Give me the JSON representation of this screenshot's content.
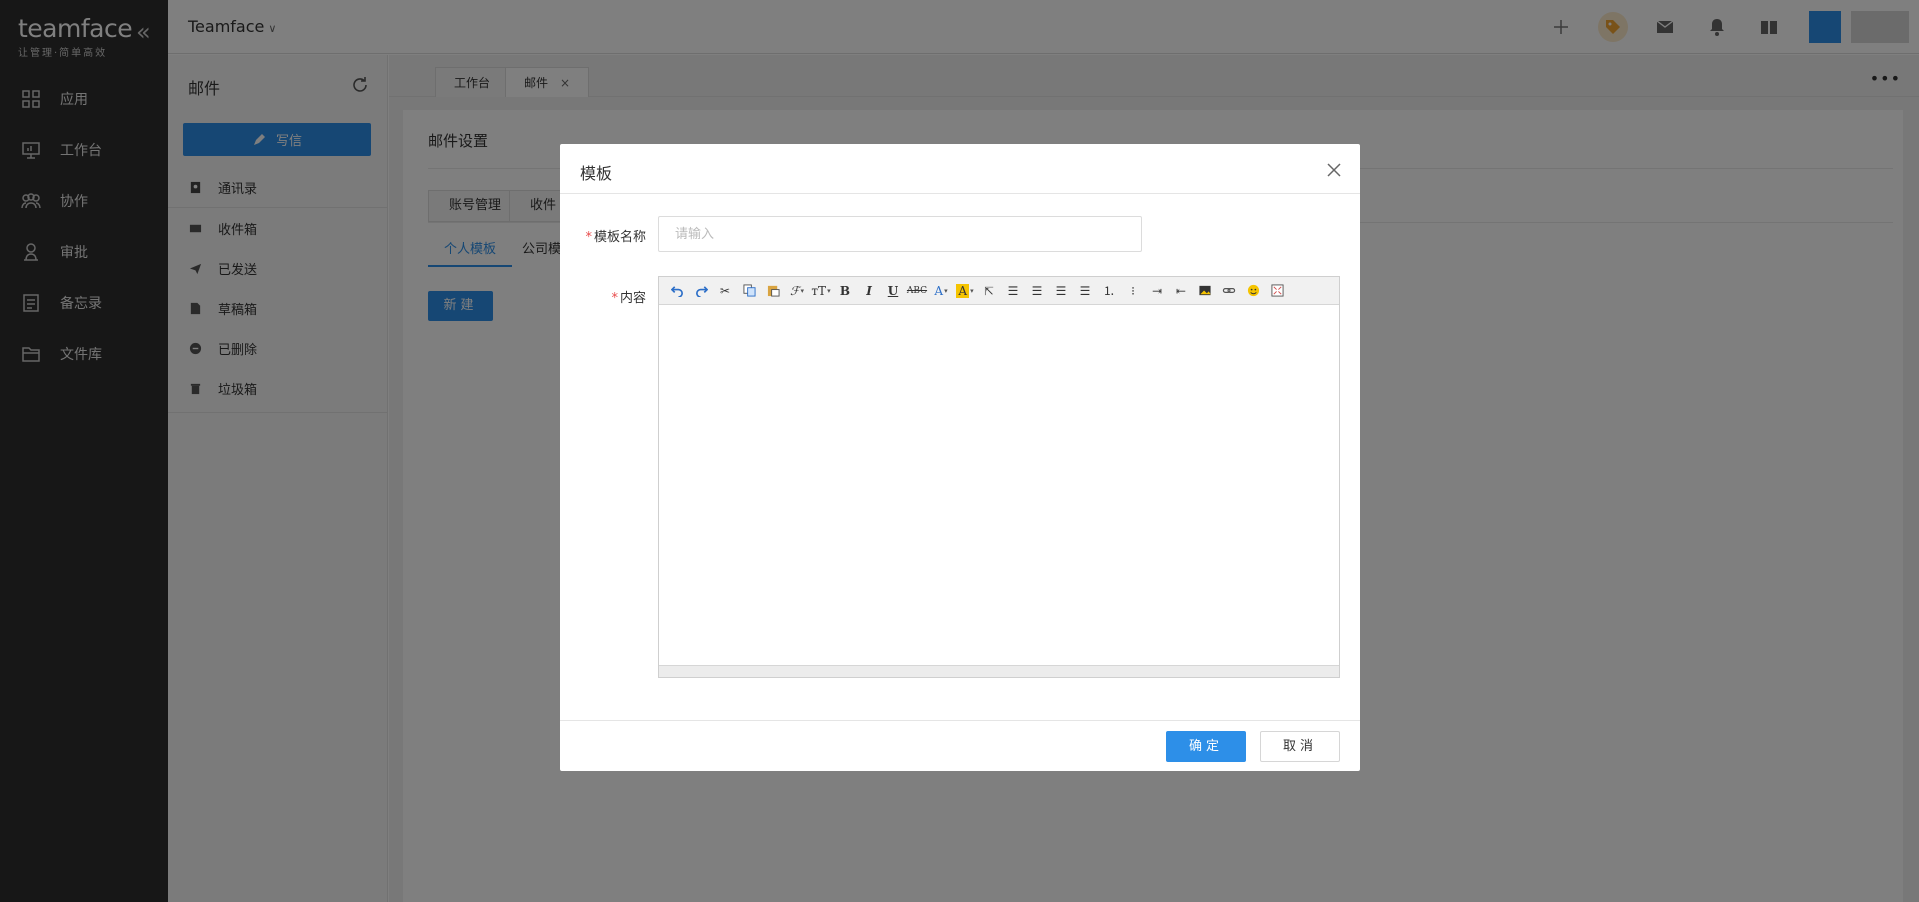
{
  "brand": {
    "logo_text": "teamface",
    "tagline": "让管理·简单高效"
  },
  "leftnav": {
    "items": [
      {
        "label": "应用",
        "icon": "apps-icon"
      },
      {
        "label": "工作台",
        "icon": "dashboard-icon"
      },
      {
        "label": "协作",
        "icon": "collaboration-icon"
      },
      {
        "label": "审批",
        "icon": "approval-icon"
      },
      {
        "label": "备忘录",
        "icon": "memo-icon"
      },
      {
        "label": "文件库",
        "icon": "folder-icon"
      }
    ]
  },
  "header": {
    "company": "Teamface"
  },
  "mail": {
    "title": "邮件",
    "compose_label": "写信",
    "contacts_label": "通讯录",
    "folders": [
      {
        "label": "收件箱"
      },
      {
        "label": "已发送"
      },
      {
        "label": "草稿箱"
      },
      {
        "label": "已删除"
      },
      {
        "label": "垃圾箱"
      }
    ]
  },
  "tabs": [
    {
      "label": "工作台"
    },
    {
      "label": "邮件",
      "active": true
    }
  ],
  "settings": {
    "title": "邮件设置",
    "subtabs": [
      "账号管理",
      "收件"
    ],
    "template_tabs": [
      "个人模板",
      "公司模"
    ],
    "new_button": "新建"
  },
  "modal": {
    "title": "模板",
    "name_label": "模板名称",
    "name_placeholder": "请输入",
    "content_label": "内容",
    "ok_label": "确定",
    "cancel_label": "取消"
  },
  "colors": {
    "primary": "#2d8fe8",
    "nav_bg": "#2f2f2f",
    "required": "#e84a4a"
  }
}
